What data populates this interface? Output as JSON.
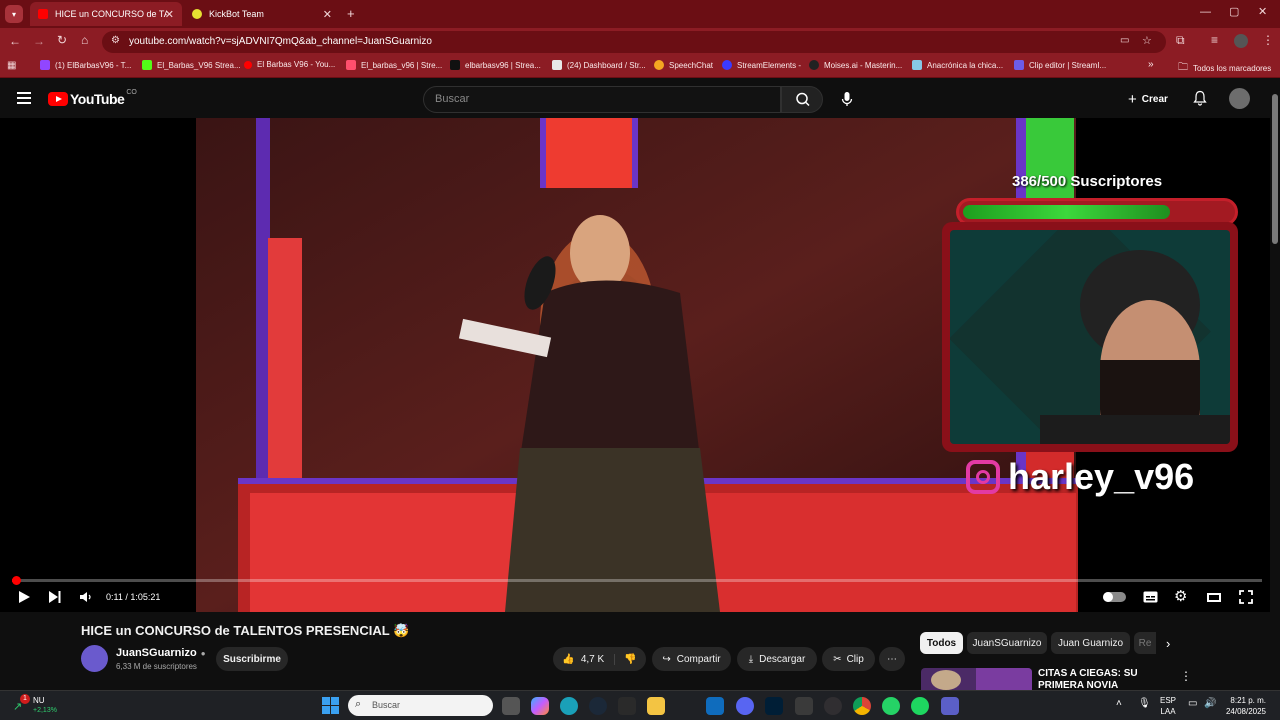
{
  "browser": {
    "tabs": [
      {
        "title": "HICE un CONCURSO de TALENTOS",
        "active": true
      },
      {
        "title": "KickBot Team",
        "active": false
      }
    ],
    "address": "youtube.com/watch?v=sjADVNI7QmQ&ab_channel=JuanSGuarnizo",
    "bookmarks": [
      "(1) ElBarbasV96 - T...",
      "El_Barbas_V96 Strea...",
      "El Barbas V96 - You...",
      "El_barbas_v96 | Stre...",
      "elbarbasv96 | Strea...",
      "(24) Dashboard / Str...",
      "SpeechChat",
      "StreamElements -",
      "Moises.ai - Masterin...",
      "Anacrónica la chica...",
      "Clip editor | StreamI..."
    ],
    "bookmarks_more": "»",
    "all_bookmarks": "Todos los marcadores"
  },
  "youtube": {
    "logo_text": "YouTube",
    "logo_region": "CO",
    "search_placeholder": "Buscar",
    "create_label": "Crear",
    "player": {
      "time": "0:11 / 1:05:21",
      "progress": 0.003
    },
    "overlay": {
      "subs_text": "386/500 Suscriptores",
      "subs_fraction": 0.772,
      "instagram": "harley_v96"
    },
    "video_title": "HICE un CONCURSO de TALENTOS PRESENCIAL 🤯",
    "channel": {
      "name": "JuanSGuarnizo",
      "subscribers": "6,33 M de suscriptores",
      "subscribe_label": "Suscribirme"
    },
    "actions": {
      "likes": "4,7 K",
      "share": "Compartir",
      "download": "Descargar",
      "clip": "Clip"
    },
    "chips": [
      "Todos",
      "JuanSGuarnizo",
      "Juan Guarnizo",
      "Re"
    ],
    "next_video_title": "CITAS A CIEGAS: SU PRIMERA NOVIA"
  },
  "taskbar": {
    "weather_label": "NU",
    "weather_change": "+2,13%",
    "notification_count": "1",
    "search_placeholder": "Buscar",
    "lang": "ESP",
    "lang_sub": "LAA",
    "time": "8:21 p. m.",
    "date": "24/08/2025"
  }
}
